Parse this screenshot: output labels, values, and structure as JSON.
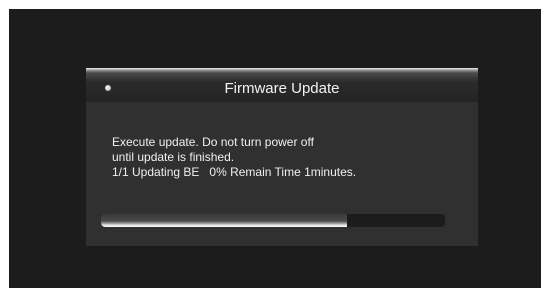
{
  "dialog": {
    "title": "Firmware Update",
    "message_lines": [
      "Execute update. Do not turn power off",
      "until update is finished.",
      "1/1 Updating BE   0% Remain Time 1minutes."
    ],
    "progress_fraction": 0.715
  },
  "icons": {
    "title_dot": "status-dot-icon"
  }
}
